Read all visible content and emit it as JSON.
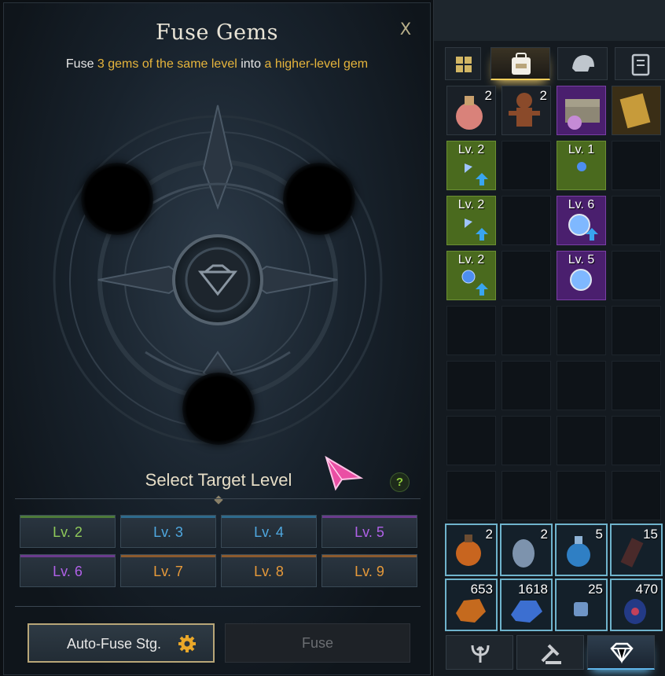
{
  "fuse_panel": {
    "title": "Fuse Gems",
    "close_label": "X",
    "subtitle": {
      "p1": "Fuse ",
      "hl1": "3 gems of the same level",
      "p2": " into ",
      "hl2": "a higher-level gem"
    },
    "select_label": "Select Target Level",
    "help_label": "?",
    "levels": [
      {
        "label": "Lv. 2",
        "color": "#8fc95a"
      },
      {
        "label": "Lv. 3",
        "color": "#4fa8e0"
      },
      {
        "label": "Lv. 4",
        "color": "#4fa8e0"
      },
      {
        "label": "Lv. 5",
        "color": "#b061e8"
      },
      {
        "label": "Lv. 6",
        "color": "#b061e8"
      },
      {
        "label": "Lv. 7",
        "color": "#e79a3a"
      },
      {
        "label": "Lv. 8",
        "color": "#e79a3a"
      },
      {
        "label": "Lv. 9",
        "color": "#e79a3a"
      }
    ],
    "autofuse_label": "Auto-Fuse Stg.",
    "fuse_label": "Fuse"
  },
  "inventory": {
    "tabs": [
      "grid-icon",
      "bag-icon",
      "helmet-icon",
      "book-icon"
    ],
    "active_tab": "bag-icon",
    "top_items": [
      {
        "icon": "potion-flask-icon",
        "count": "2"
      },
      {
        "icon": "voodoo-doll-icon",
        "count": "2"
      },
      {
        "icon": "treasure-chest-icon",
        "count": ""
      },
      {
        "icon": "scroll-card-icon",
        "count": ""
      }
    ],
    "gems": [
      {
        "level": "Lv. 2",
        "rarity": "green",
        "upgrade": true
      },
      {
        "level": "Lv. 1",
        "rarity": "green",
        "upgrade": false
      },
      {
        "level": "Lv. 2",
        "rarity": "green",
        "upgrade": true
      },
      {
        "level": "Lv. 6",
        "rarity": "purple",
        "upgrade": true
      },
      {
        "level": "Lv. 2",
        "rarity": "green",
        "upgrade": true
      },
      {
        "level": "Lv. 5",
        "rarity": "purple",
        "upgrade": false
      }
    ],
    "quick_items": [
      {
        "icon": "fire-potion-icon",
        "count": "2"
      },
      {
        "icon": "clear-potion-icon",
        "count": "2"
      },
      {
        "icon": "blue-potion-icon",
        "count": "5"
      },
      {
        "icon": "dark-bottle-icon",
        "count": "15"
      },
      {
        "icon": "amber-ore-icon",
        "count": "653"
      },
      {
        "icon": "blue-crystal-icon",
        "count": "1618"
      },
      {
        "icon": "blue-die-icon",
        "count": "25"
      },
      {
        "icon": "dark-orb-icon",
        "count": "470"
      }
    ],
    "bottom_tabs": [
      "trident-icon",
      "hammer-icon",
      "gem-icon"
    ],
    "active_bottom_tab": "gem-icon"
  }
}
